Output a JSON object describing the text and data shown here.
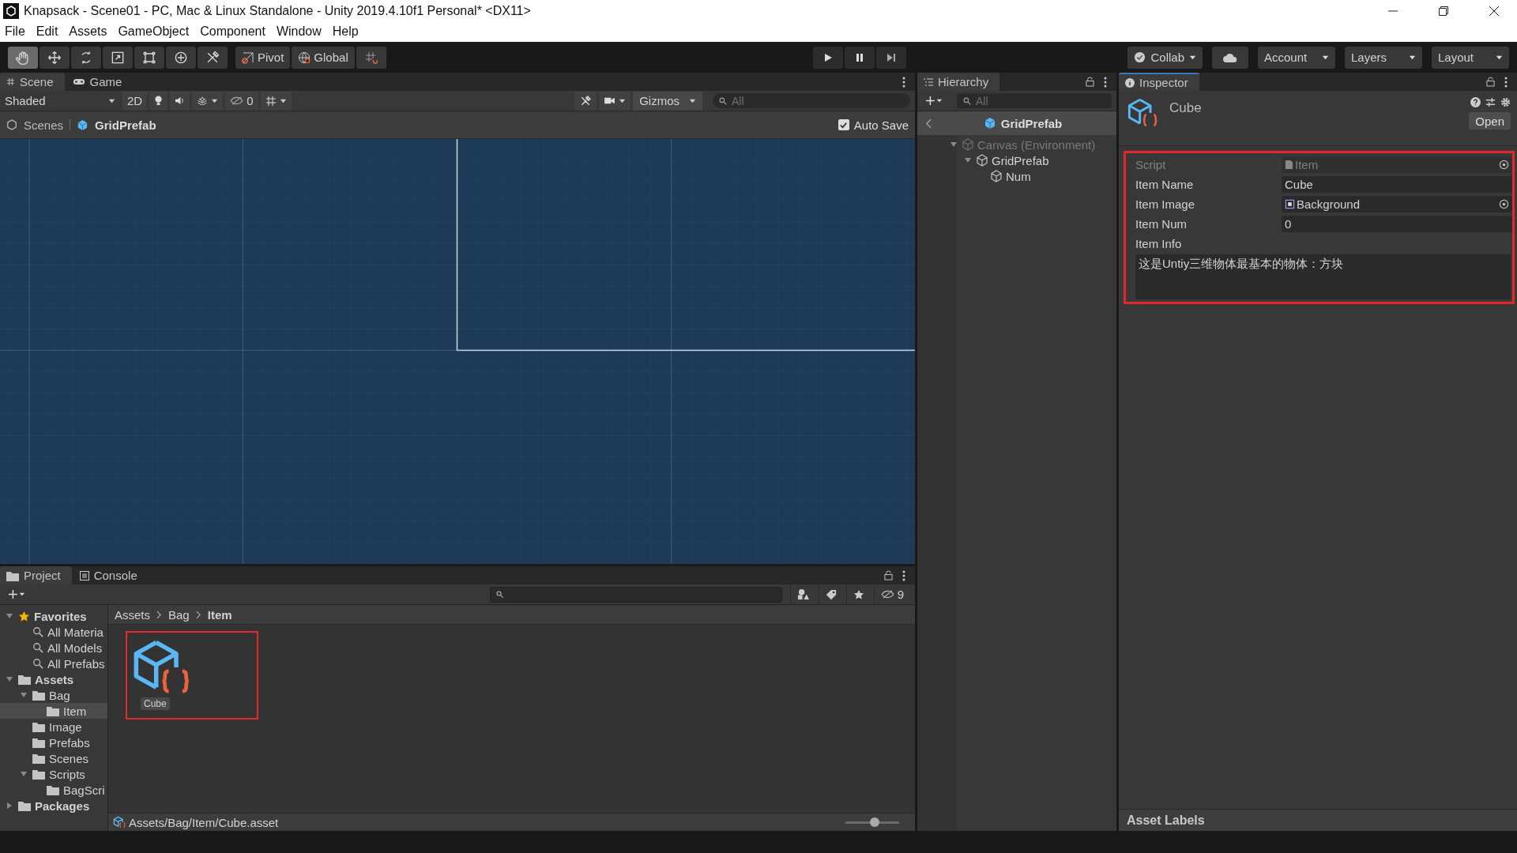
{
  "window": {
    "title": "Knapsack - Scene01 - PC, Mac & Linux Standalone - Unity 2019.4.10f1 Personal* <DX11>"
  },
  "menu": [
    "File",
    "Edit",
    "Assets",
    "GameObject",
    "Component",
    "Window",
    "Help"
  ],
  "toolbar": {
    "tools": [
      {
        "kind": "hand",
        "selected": true
      },
      {
        "kind": "move",
        "selected": false
      },
      {
        "kind": "rotate",
        "selected": false
      },
      {
        "kind": "scale",
        "selected": false
      },
      {
        "kind": "rect",
        "selected": false
      },
      {
        "kind": "transform",
        "selected": false
      },
      {
        "kind": "custom",
        "selected": false
      }
    ],
    "pivot": "Pivot",
    "global": "Global",
    "collab": "Collab",
    "account": "Account",
    "layers": "Layers",
    "layout": "Layout"
  },
  "scene_panel": {
    "tabs": [
      {
        "label": "Scene",
        "kind": "scene",
        "selected": true
      },
      {
        "label": "Game",
        "kind": "game",
        "selected": false
      }
    ],
    "shading": "Shaded",
    "mode_2d": "2D",
    "hidden_count": "0",
    "gizmos": "Gizmos",
    "search": {
      "placeholder": "All"
    },
    "breadcrumb": [
      "Scenes",
      "GridPrefab"
    ],
    "auto_save": {
      "label": "Auto Save",
      "checked": true
    }
  },
  "hierarchy": {
    "title": "Hierarchy",
    "search": {
      "placeholder": "All"
    },
    "header": "GridPrefab",
    "tree": [
      {
        "label": "Canvas (Environment)",
        "disabled": true,
        "expanded": true,
        "children": [
          {
            "label": "GridPrefab",
            "disabled": false,
            "expanded": true,
            "children": [
              {
                "label": "Num",
                "disabled": false
              }
            ]
          }
        ]
      }
    ]
  },
  "inspector": {
    "title": "Inspector",
    "object_name": "Cube",
    "open_button": "Open",
    "fields": [
      {
        "label": "Script",
        "value": "Item",
        "kind": "script",
        "disabled": true
      },
      {
        "label": "Item Name",
        "value": "Cube",
        "kind": "text",
        "disabled": false
      },
      {
        "label": "Item Image",
        "value": "Background",
        "kind": "sprite",
        "disabled": false
      },
      {
        "label": "Item Num",
        "value": "0",
        "kind": "text",
        "disabled": false
      },
      {
        "label": "Item Info",
        "value": "这是Untiy三维物体最基本的物体：方块",
        "kind": "textarea",
        "disabled": false
      }
    ],
    "asset_labels": "Asset Labels"
  },
  "project": {
    "tabs": [
      {
        "label": "Project",
        "kind": "project",
        "selected": true
      },
      {
        "label": "Console",
        "kind": "console",
        "selected": false
      }
    ],
    "hidden_count": "9",
    "tree": [
      {
        "label": "Favorites",
        "kind": "favorites",
        "expanded": true,
        "selected": false,
        "children": [
          {
            "label": "All Materia",
            "kind": "search",
            "selected": false
          },
          {
            "label": "All Models",
            "kind": "search",
            "selected": false
          },
          {
            "label": "All Prefabs",
            "kind": "search",
            "selected": false
          }
        ]
      },
      {
        "label": "Assets",
        "kind": "folder",
        "expanded": true,
        "selected": false,
        "children": [
          {
            "label": "Bag",
            "kind": "folder",
            "expanded": true,
            "selected": false,
            "children": [
              {
                "label": "Item",
                "kind": "folder",
                "selected": true
              }
            ]
          },
          {
            "label": "Image",
            "kind": "folder",
            "selected": false
          },
          {
            "label": "Prefabs",
            "kind": "folder",
            "selected": false
          },
          {
            "label": "Scenes",
            "kind": "folder",
            "selected": false
          },
          {
            "label": "Scripts",
            "kind": "folder",
            "expanded": true,
            "selected": false,
            "children": [
              {
                "label": "BagScri",
                "kind": "folder",
                "selected": false
              }
            ]
          }
        ]
      },
      {
        "label": "Packages",
        "kind": "folder",
        "expanded": false,
        "selected": false
      }
    ],
    "breadcrumb": [
      "Assets",
      "Bag",
      "Item"
    ],
    "assets": [
      {
        "label": "Cube",
        "highlighted": true
      }
    ],
    "path": "Assets/Bag/Item/Cube.asset",
    "zoom": {
      "level": 0.55
    }
  }
}
